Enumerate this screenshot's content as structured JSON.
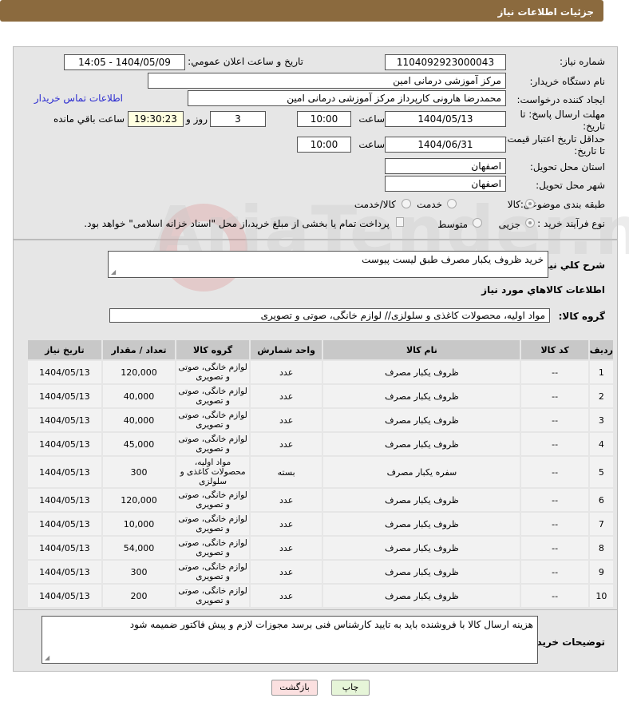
{
  "header": {
    "title": "جزئیات اطلاعات نیاز"
  },
  "form": {
    "need_number_label": "شماره نیاز:",
    "need_number": "1104092923000043",
    "announce_label": "تاریخ و ساعت اعلان عمومي:",
    "announce_value": "1404/05/09 - 14:05",
    "buyer_label": "نام دستگاه خریدار:",
    "buyer": "مرکز آموزشی درمانی امین",
    "creator_label": "ایجاد کننده درخواست:",
    "creator": "محمدرضا هارونی کارپرداز مرکز آموزشی درمانی امین",
    "contact_link": "اطلاعات تماس خریدار",
    "deadline_label": "مهلت ارسال پاسخ: تا تاریخ:",
    "deadline_date": "1404/05/13",
    "time_label": "ساعت",
    "deadline_time": "10:00",
    "days": "3",
    "days_label": "روز و",
    "remaining": "19:30:23",
    "remaining_label": "ساعت باقي مانده",
    "validity_label": "حداقل تاريخ اعتبار قيمت: تا تاريخ:",
    "validity_date": "1404/06/31",
    "validity_time": "10:00",
    "province_label": "استان محل تحویل:",
    "province": "اصفهان",
    "city_label": "شهر محل تحویل:",
    "city": "اصفهان",
    "category_label": "طبقه بندی موضوعی:",
    "category_options": [
      "کالا",
      "خدمت",
      "کالا/خدمت"
    ],
    "process_label": "نوع فرآیند خرید :",
    "process_options": [
      "جزیی",
      "متوسط"
    ],
    "payment_note": "پرداخت تمام یا بخشی از مبلغ خرید،از محل \"اسناد خزانه اسلامی\" خواهد بود."
  },
  "summary": {
    "label": "شرح کلي نياز:",
    "value": "خرید ظروف یکبار مصرف طبق لیست پیوست"
  },
  "items_title": "اطلاعات کالاهاي مورد نياز",
  "group": {
    "label": "گروه کالا:",
    "value": "مواد اولیه، محصولات کاغذی و سلولزی// لوازم خانگی، صوتی و تصویری"
  },
  "table": {
    "headers": [
      "ردیف",
      "کد کالا",
      "نام کالا",
      "واحد شمارش",
      "گروه کالا",
      "تعداد / مقدار",
      "تاریخ نیاز"
    ],
    "rows": [
      [
        "1",
        "--",
        "ظروف یکبار مصرف",
        "عدد",
        "لوازم خانگی، صوتی و تصویری",
        "120,000",
        "1404/05/13"
      ],
      [
        "2",
        "--",
        "ظروف یکبار مصرف",
        "عدد",
        "لوازم خانگی، صوتی و تصویری",
        "40,000",
        "1404/05/13"
      ],
      [
        "3",
        "--",
        "ظروف یکبار مصرف",
        "عدد",
        "لوازم خانگی، صوتی و تصویری",
        "40,000",
        "1404/05/13"
      ],
      [
        "4",
        "--",
        "ظروف یکبار مصرف",
        "عدد",
        "لوازم خانگی، صوتی و تصویری",
        "45,000",
        "1404/05/13"
      ],
      [
        "5",
        "--",
        "سفره یکبار مصرف",
        "بسته",
        "مواد اولیه، محصولات کاغذی و سلولزی",
        "300",
        "1404/05/13"
      ],
      [
        "6",
        "--",
        "ظروف یکبار مصرف",
        "عدد",
        "لوازم خانگی، صوتی و تصویری",
        "120,000",
        "1404/05/13"
      ],
      [
        "7",
        "--",
        "ظروف یکبار مصرف",
        "عدد",
        "لوازم خانگی، صوتی و تصویری",
        "10,000",
        "1404/05/13"
      ],
      [
        "8",
        "--",
        "ظروف یکبار مصرف",
        "عدد",
        "لوازم خانگی، صوتی و تصویری",
        "54,000",
        "1404/05/13"
      ],
      [
        "9",
        "--",
        "ظروف یکبار مصرف",
        "عدد",
        "لوازم خانگی، صوتی و تصویری",
        "300",
        "1404/05/13"
      ],
      [
        "10",
        "--",
        "ظروف یکبار مصرف",
        "عدد",
        "لوازم خانگی، صوتی و تصویری",
        "200",
        "1404/05/13"
      ]
    ]
  },
  "notes": {
    "label": "توضیحات خریدار:",
    "value": "هزینه ارسال کالا با فروشنده باید به تایید کارشناس فنی برسد مجوزات لازم و پیش فاکتور ضمیمه شود"
  },
  "buttons": {
    "print": "چاپ",
    "back": "بازگشت"
  },
  "watermark": "AriaTender.net"
}
